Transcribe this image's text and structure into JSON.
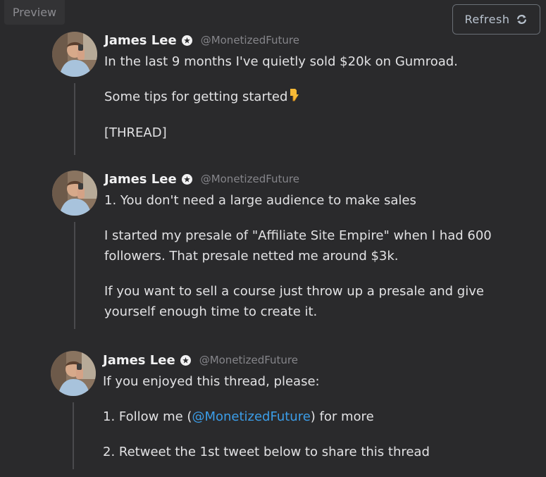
{
  "preview_tab": {
    "label": "Preview"
  },
  "refresh_button": {
    "label": "Refresh",
    "icon": "refresh-icon"
  },
  "colors": {
    "background": "#2a2a2c",
    "mention": "#3b9de8",
    "button_border": "#6a6f76",
    "thread_line": "#4a4a4d"
  },
  "tweets": [
    {
      "name": "James Lee",
      "handle": "@MonetizedFuture",
      "paragraphs": [
        "In the last 9 months I've quietly sold $20k on Gumroad.",
        "Some tips for getting started",
        "[THREAD]"
      ],
      "emoji": "pointing-down-icon"
    },
    {
      "name": "James Lee",
      "handle": "@MonetizedFuture",
      "paragraphs": [
        "1. You don't need a large audience to make sales",
        "I started my presale of \"Affiliate Site Empire\" when I had 600",
        "followers. That presale netted me around $3k.",
        "If you want to sell a course just throw up a presale and give",
        "yourself enough time to create it."
      ]
    },
    {
      "name": "James Lee",
      "handle": "@MonetizedFuture",
      "paragraphs": [
        "If you enjoyed this thread, please:",
        "1. Follow me (",
        "@MonetizedFuture",
        ") for more",
        "2. Retweet the 1st tweet below to share this thread"
      ]
    }
  ]
}
